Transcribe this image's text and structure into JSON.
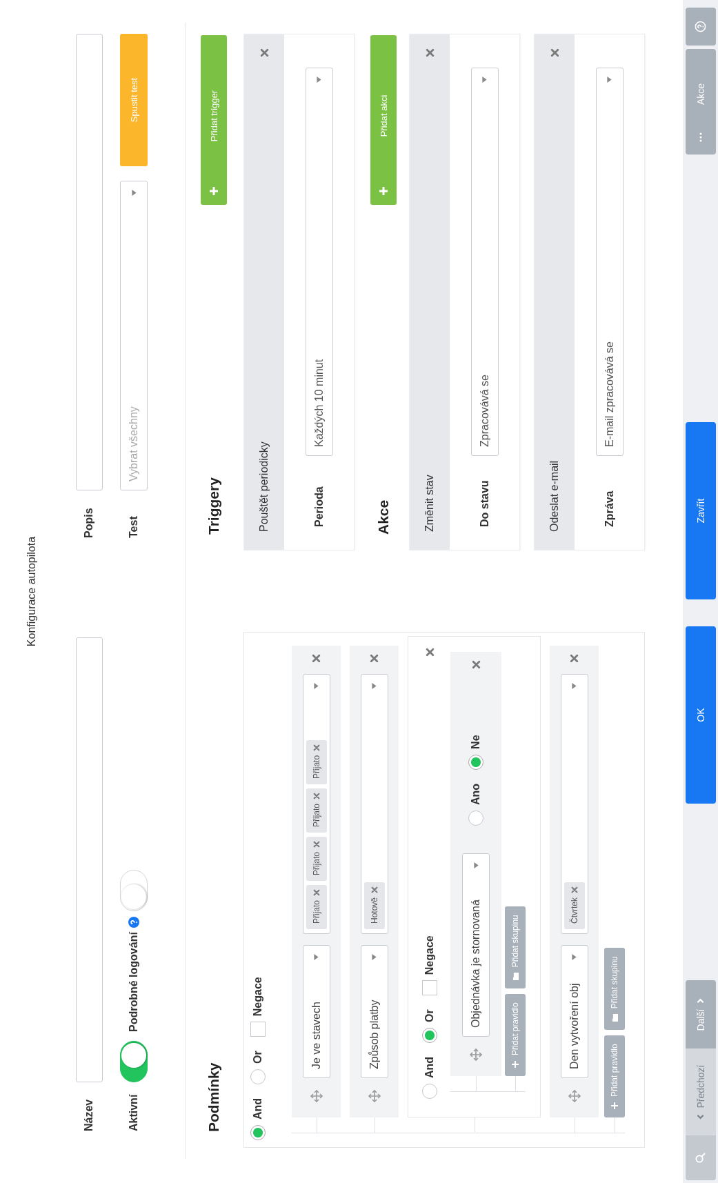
{
  "title": "Konfigurace autopilota",
  "form": {
    "name": {
      "label": "Název"
    },
    "active": {
      "label": "Aktivní",
      "on": true
    },
    "verbose_logging": {
      "label": "Podrobné logování",
      "on": false
    },
    "description": {
      "label": "Popis"
    },
    "test": {
      "label": "Test",
      "placeholder": "Vybrat všechny",
      "button": "Spustit test"
    }
  },
  "conditions": {
    "title": "Podmínky",
    "group": {
      "removable": false,
      "operators": [
        {
          "label": "And",
          "selected": true
        },
        {
          "label": "Or",
          "selected": false
        }
      ],
      "negation": {
        "label": "Negace",
        "checked": false
      },
      "items": [
        {
          "kind": "rule",
          "field": "Je ve stavech",
          "tags": [
            "Přijato",
            "Přijato",
            "Přijato",
            "Přijato"
          ]
        },
        {
          "kind": "rule",
          "field": "Způsob platby",
          "tags": [
            "Hotově"
          ]
        },
        {
          "kind": "group",
          "removable": true,
          "operators": [
            {
              "label": "And",
              "selected": false
            },
            {
              "label": "Or",
              "selected": true
            }
          ],
          "negation": {
            "label": "Negace",
            "checked": false
          },
          "items": [
            {
              "kind": "boolean",
              "field": "Objednávka je stornovaná",
              "options": [
                {
                  "label": "Ano",
                  "selected": false
                },
                {
                  "label": "Ne",
                  "selected": true
                }
              ]
            }
          ],
          "add_rule": "Přidat pravidlo",
          "add_group": "Přidat skupinu"
        },
        {
          "kind": "rule",
          "field": "Den vytvoření obj",
          "tags": [
            "Čtvrtek"
          ]
        }
      ],
      "add_rule": "Přidat pravidlo",
      "add_group": "Přidat skupinu"
    }
  },
  "triggers": {
    "title": "Triggery",
    "add_button": "Přidat trigger",
    "items": [
      {
        "title": "Pouštět periodicky",
        "field_label": "Perioda",
        "value": "Každých 10 minut"
      }
    ]
  },
  "actions": {
    "title": "Akce",
    "add_button": "Přidat akci",
    "items": [
      {
        "title": "Změnit stav",
        "field_label": "Do stavu",
        "value": "Zpracovává se"
      },
      {
        "title": "Odeslat e-mail",
        "field_label": "Zpráva",
        "value": "E-mail zpracovává se"
      }
    ]
  },
  "footer": {
    "nav": [
      {
        "label": "Předchozí",
        "disabled": true
      },
      {
        "label": "Další",
        "disabled": false
      }
    ],
    "buttons": [
      "OK",
      "Zavřít"
    ],
    "actions_button": "Akce"
  }
}
